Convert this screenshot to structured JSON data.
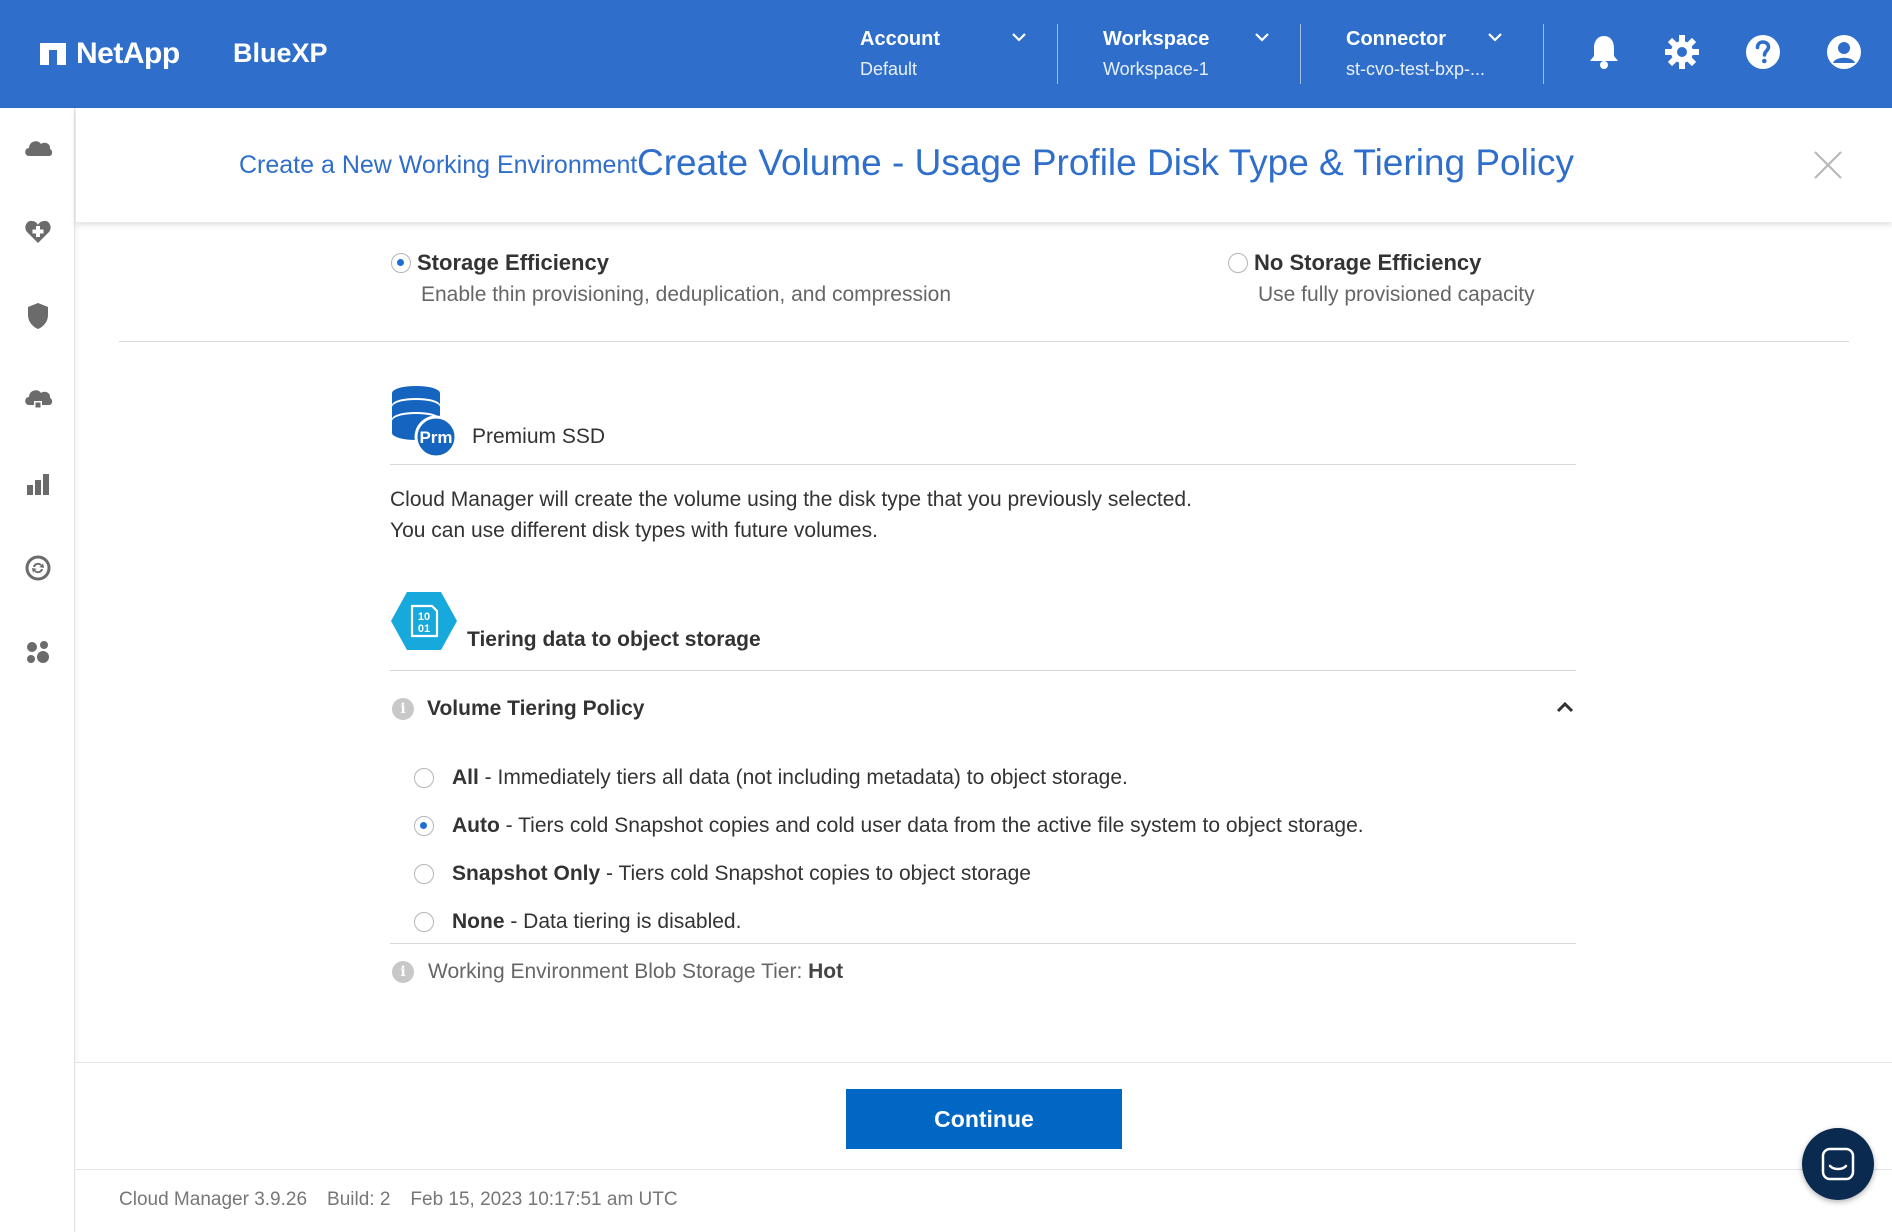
{
  "app": {
    "brand": "NetApp",
    "product": "BlueXP"
  },
  "header": {
    "account": {
      "label": "Account",
      "value": "Default"
    },
    "workspace": {
      "label": "Workspace",
      "value": "Workspace-1"
    },
    "connector": {
      "label": "Connector",
      "value": "st-cvo-test-bxp-..."
    },
    "icons": [
      "bell-icon",
      "gear-icon",
      "help-icon",
      "user-icon"
    ]
  },
  "sidebar": {
    "items": [
      "storage-icon",
      "health-icon",
      "protection-icon",
      "governance-icon",
      "analytics-icon",
      "sync-icon",
      "applications-icon"
    ]
  },
  "dialog": {
    "breadcrumb": "Create a New Working Environment",
    "title": "Create Volume - Usage Profile Disk Type & Tiering Policy"
  },
  "efficiency": {
    "selected": "storage_efficiency",
    "options": [
      {
        "title": "Storage Efficiency",
        "description": "Enable thin provisioning, deduplication, and compression",
        "checked": true
      },
      {
        "title": "No Storage Efficiency",
        "description": "Use fully provisioned capacity",
        "checked": false
      }
    ]
  },
  "disk": {
    "icon_badge": "Prm",
    "title": "Premium SSD",
    "description_line1": "Cloud Manager will create the volume using the disk type that you previously selected.",
    "description_line2": "You can use different disk types with future volumes."
  },
  "tiering": {
    "icon_text_top": "10",
    "icon_text_bottom": "01",
    "title": "Tiering data to object storage",
    "policy_label": "Volume Tiering Policy",
    "selected": "Auto",
    "options": [
      {
        "name": "All",
        "description": " - Immediately tiers all data (not including metadata) to object storage.",
        "checked": false
      },
      {
        "name": "Auto",
        "description": " - Tiers cold Snapshot copies and cold user data from the active file system to object storage.",
        "checked": true
      },
      {
        "name": "Snapshot Only",
        "description": " - Tiers cold Snapshot copies to object storage",
        "checked": false
      },
      {
        "name": "None",
        "description": " - Data tiering is disabled.",
        "checked": false
      }
    ],
    "blob_label": "Working Environment Blob Storage Tier: ",
    "blob_value": "Hot"
  },
  "footer": {
    "continue_label": "Continue",
    "version": "Cloud Manager 3.9.26",
    "build": "Build: 2",
    "timestamp": "Feb 15, 2023 10:17:51 am UTC"
  },
  "colors": {
    "brand_blue": "#2f6fcb",
    "button_blue": "#0067c5",
    "chat_navy": "#0b2a4f",
    "tier_icon": "#17a8dc"
  }
}
